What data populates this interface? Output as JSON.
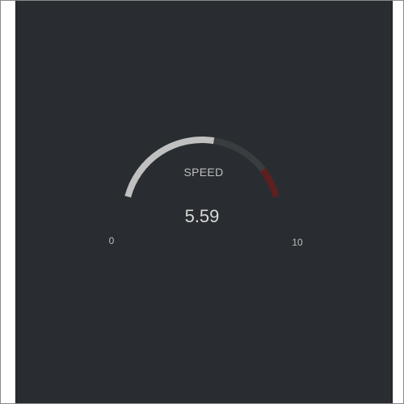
{
  "gauge": {
    "title": "SPEED",
    "value": 5.59,
    "value_label": "5.59",
    "min": 0,
    "max": 10,
    "min_label": "0",
    "max_label": "10",
    "danger_from": 8.5,
    "colors": {
      "background": "#292d31",
      "track": "#3a3d40",
      "fill": "#c0c0c0",
      "danger": "#5e1f1f",
      "text": "#bdbdbd"
    }
  }
}
